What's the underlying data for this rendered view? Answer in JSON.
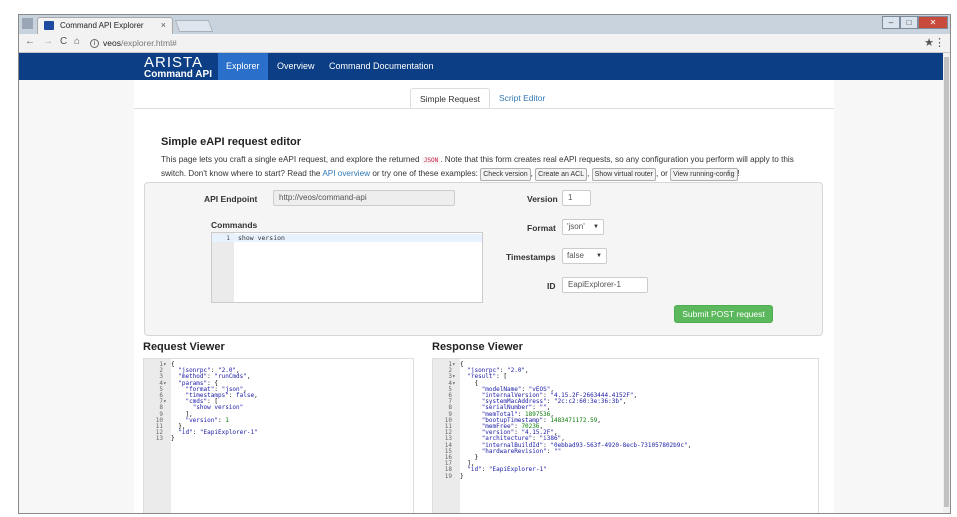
{
  "browser": {
    "tab_title": "Command API Explorer",
    "tab_close": "×",
    "url_host": "veos",
    "url_path": "/explorer.html#",
    "back": "←",
    "forward": "→",
    "reload": "C",
    "home": "⌂",
    "info": "i",
    "star": "★",
    "menu": "⋮",
    "win_min": "–",
    "win_max": "□",
    "win_close": "✕"
  },
  "app": {
    "logo_line1": "ARISTA",
    "logo_line2": "Command API",
    "nav": [
      "Explorer",
      "Overview",
      "Command Documentation"
    ]
  },
  "tabs": [
    "Simple Request",
    "Script Editor"
  ],
  "heading": "Simple eAPI request editor",
  "description": {
    "p1": "This page lets you craft a single eAPI request, and explore the returned",
    "code": "JSON",
    "p2": ". Note that this form creates real eAPI requests, so any configuration you perform will apply to this switch. Don't know where to start? Read the",
    "link": "API overview",
    "p3": "or try one of these examples:",
    "examples": [
      "Check version",
      "Create an ACL",
      "Show virtual router",
      "View running-config"
    ],
    "p4": ", or"
  },
  "form": {
    "endpoint_label": "API Endpoint",
    "endpoint_value": "http://veos/command-api",
    "commands_label": "Commands",
    "commands": [
      "show version"
    ],
    "version_label": "Version",
    "version_value": "1",
    "format_label": "Format",
    "format_value": "'json'",
    "timestamps_label": "Timestamps",
    "timestamps_value": "false",
    "id_label": "ID",
    "id_value": "EapiExplorer-1",
    "submit_label": "Submit POST request"
  },
  "request_viewer": {
    "title": "Request Viewer",
    "lines": [
      "{",
      "  \"jsonrpc\": \"2.0\",",
      "  \"method\": \"runCmds\",",
      "  \"params\": {",
      "    \"format\": \"json\",",
      "    \"timestamps\": false,",
      "    \"cmds\": [",
      "      \"show version\"",
      "    ],",
      "    \"version\": 1",
      "  },",
      "  \"id\": \"EapiExplorer-1\"",
      "}"
    ],
    "folds": [
      1,
      4,
      7
    ]
  },
  "response_viewer": {
    "title": "Response Viewer",
    "lines": [
      "{",
      "  \"jsonrpc\": \"2.0\",",
      "  \"result\": [",
      "    {",
      "      \"modelName\": \"vEOS\",",
      "      \"internalVersion\": \"4.15.2F-2663444.4152F\",",
      "      \"systemMacAddress\": \"2c:c2:60:3e:36:3b\",",
      "      \"serialNumber\": \"\",",
      "      \"memTotal\": 1897536,",
      "      \"bootupTimestamp\": 1483471172.59,",
      "      \"memFree\": 70236,",
      "      \"version\": \"4.15.2F\",",
      "      \"architecture\": \"i386\",",
      "      \"internalBuildId\": \"0ebbad93-563f-4920-8ecb-731057802b9c\",",
      "      \"hardwareRevision\": \"\"",
      "    }",
      "  ],",
      "  \"id\": \"EapiExplorer-1\"",
      "}"
    ],
    "folds": [
      1,
      3,
      4
    ]
  }
}
